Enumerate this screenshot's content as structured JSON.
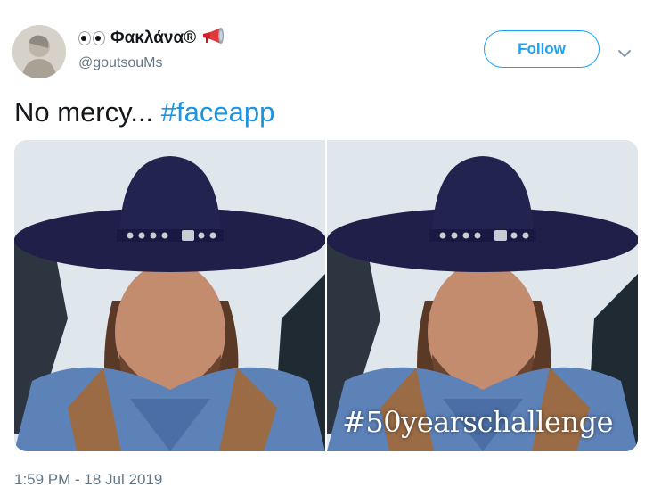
{
  "tweet": {
    "display_name": "Φακλάνα®",
    "handle": "@goutsouMs",
    "follow_label": "Follow",
    "text": "No mercy...",
    "hashtag": "#faceapp",
    "timestamp": "1:59 PM - 18 Jul 2019"
  },
  "media": {
    "overlay_hashtag": "#50yearschallenge"
  },
  "colors": {
    "accent": "#1da1f2",
    "hashtag": "#1b95e0",
    "muted": "#657786"
  },
  "icons": {
    "eyes": "eyes-emoji-icon",
    "megaphone": "megaphone-emoji-icon",
    "more": "chevron-down-icon"
  }
}
